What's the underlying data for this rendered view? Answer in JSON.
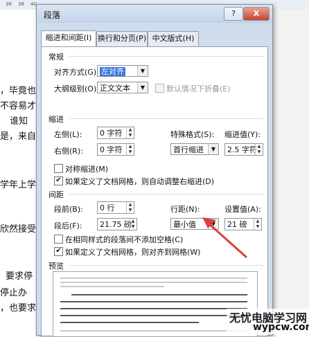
{
  "ruler": {
    "ticks": [
      "36",
      "38",
      "40"
    ]
  },
  "document": {
    "lines": [
      "，毕竟也",
      "不容易才",
      "谁知",
      "是，来自",
      "学年上学",
      "欣然接受",
      "要求停",
      "停止办",
      "，也要求"
    ]
  },
  "dialog": {
    "title": "段落",
    "help": "?",
    "close": "X",
    "tabs": [
      "缩进和间距(I)",
      "换行和分页(P)",
      "中文版式(H)"
    ]
  },
  "general": {
    "section": "常规",
    "alignment_label": "对齐方式(G):",
    "alignment_value": "左对齐",
    "outline_label": "大纲级别(O):",
    "outline_value": "正文文本",
    "collapse_label": "默认情况下折叠(E)"
  },
  "indent": {
    "section": "缩进",
    "left_label": "左侧(L):",
    "left_value": "0 字符",
    "right_label": "右侧(R):",
    "right_value": "0 字符",
    "special_label": "特殊格式(S):",
    "special_value": "首行缩进",
    "amount_label": "缩进值(Y):",
    "amount_value": "2.5 字符",
    "mirror_label": "对称缩进(M)",
    "auto_adjust_label": "如果定义了文档网格，则自动调整右缩进(D)"
  },
  "spacing": {
    "section": "间距",
    "before_label": "段前(B):",
    "before_value": "0 行",
    "after_label": "段后(F):",
    "after_value": "21.75 磅",
    "line_label": "行距(N):",
    "line_value": "最小值",
    "at_label": "设置值(A):",
    "at_value": "21 磅",
    "no_space_label": "在相同样式的段落间不添加空格(C)",
    "snap_grid_label": "如果定义了文档网格，则对齐到网格(W)"
  },
  "preview": {
    "section": "预览"
  },
  "watermark": {
    "line1": "无忧电脑学习网",
    "line2": "wypcw.com"
  },
  "colors": {
    "annotation_arrow": "#d9413a",
    "selection": "#3b78d8"
  }
}
